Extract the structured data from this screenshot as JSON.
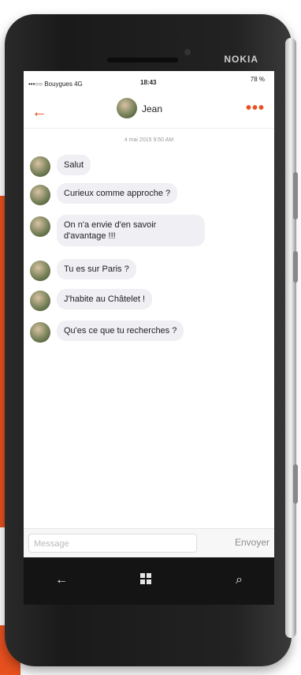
{
  "device": {
    "brand": "NOKIA"
  },
  "status_bar": {
    "carrier": "•••○○ Bouygues 4G",
    "time": "18:43",
    "battery": "78 %"
  },
  "header": {
    "back_icon": "arrow-left-icon",
    "contact_name": "Jean",
    "more_icon": "more-dots-icon"
  },
  "conversation": {
    "date": "4 mai 2015 9:50 AM",
    "messages": [
      {
        "text": "Salut"
      },
      {
        "text": "Curieux comme approche ?"
      },
      {
        "text": "On n'a envie d'en savoir d'avantage !!!"
      },
      {
        "text": "Tu es sur Paris ?"
      },
      {
        "text": "J'habite au Châtelet !"
      },
      {
        "text": "Qu'es ce que tu recherches ?"
      }
    ]
  },
  "composer": {
    "placeholder": "Message",
    "send_label": "Envoyer"
  },
  "nav": {
    "back": "←",
    "search": "⌕"
  },
  "colors": {
    "accent": "#e8501f"
  }
}
